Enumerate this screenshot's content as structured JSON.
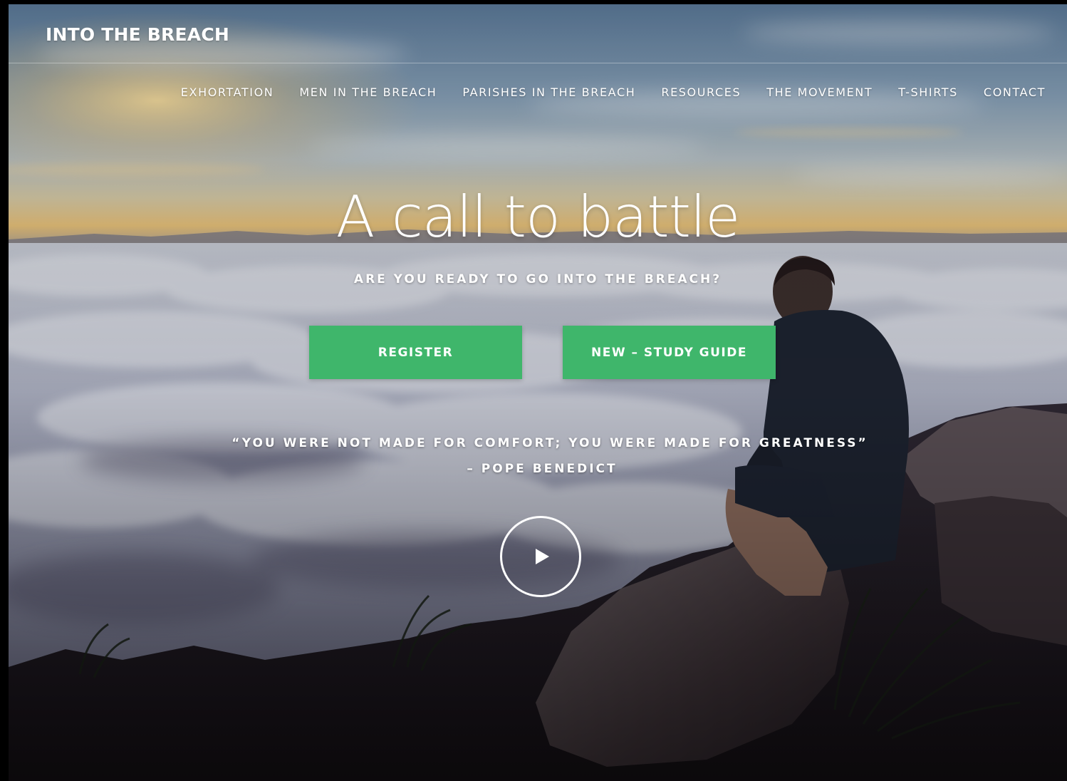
{
  "brand": {
    "title": "INTO THE BREACH"
  },
  "nav": {
    "items": [
      {
        "label": "EXHORTATION"
      },
      {
        "label": "MEN IN THE BREACH"
      },
      {
        "label": "PARISHES IN THE BREACH"
      },
      {
        "label": "RESOURCES"
      },
      {
        "label": "THE MOVEMENT"
      },
      {
        "label": "T-SHIRTS"
      },
      {
        "label": "CONTACT"
      }
    ]
  },
  "hero": {
    "headline": "A call to battle",
    "tagline": "ARE YOU READY TO GO INTO THE BREACH?",
    "buttons": {
      "register": "REGISTER",
      "study_guide": "NEW – STUDY GUIDE"
    },
    "quote": "“YOU WERE NOT MADE FOR COMFORT; YOU WERE MADE FOR GREATNESS”",
    "attribution": "– POPE BENEDICT",
    "play_icon": "play-icon"
  },
  "colors": {
    "button_green": "#3fb66b",
    "text": "#ffffff"
  }
}
